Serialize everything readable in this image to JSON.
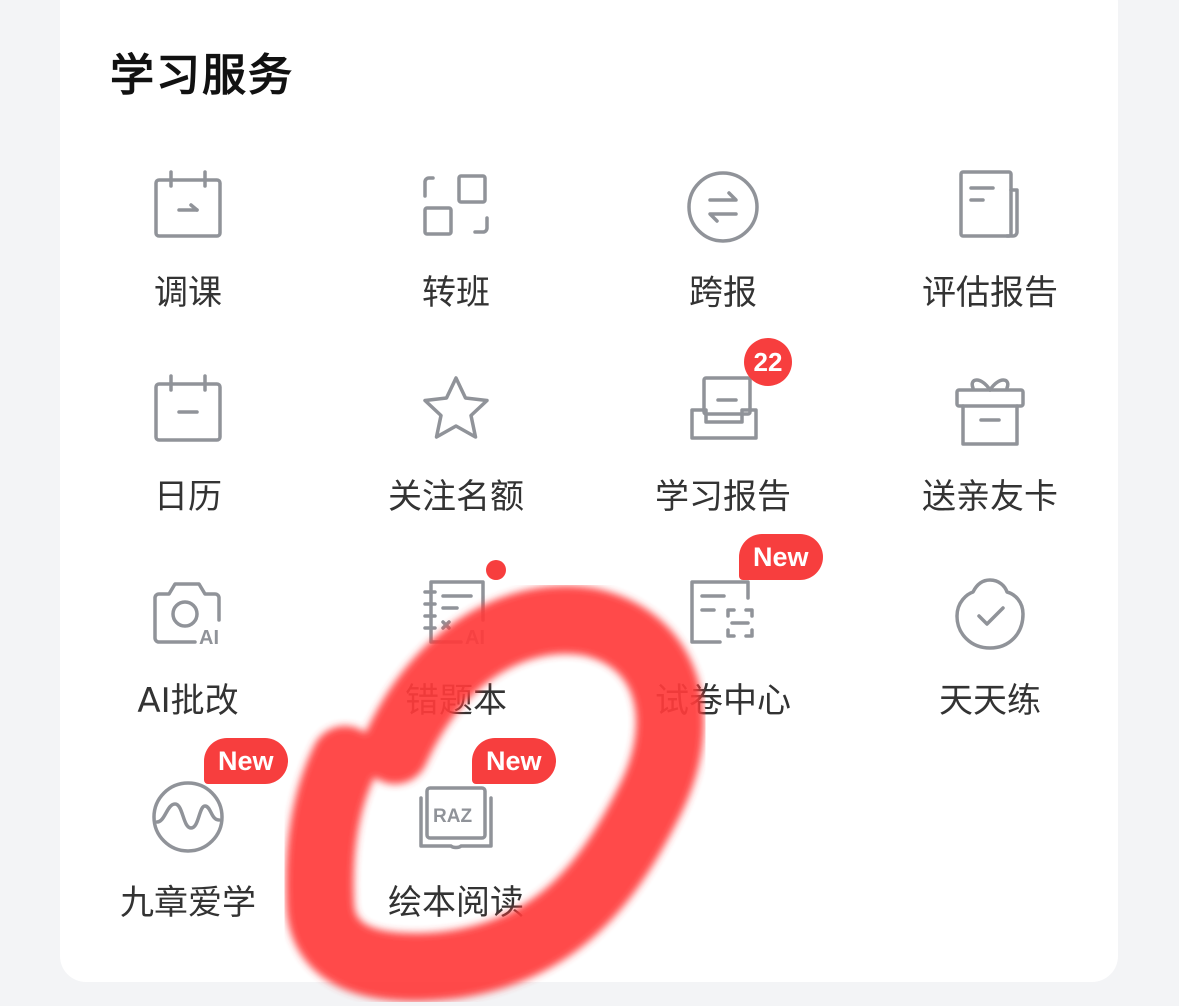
{
  "section": {
    "title": "学习服务"
  },
  "services": [
    {
      "label": "调课",
      "icon": "calendar-adjust-icon"
    },
    {
      "label": "转班",
      "icon": "transfer-class-icon"
    },
    {
      "label": "跨报",
      "icon": "exchange-circle-icon"
    },
    {
      "label": "评估报告",
      "icon": "document-report-icon"
    },
    {
      "label": "日历",
      "icon": "calendar-icon"
    },
    {
      "label": "关注名额",
      "icon": "star-icon"
    },
    {
      "label": "学习报告",
      "icon": "inbox-tray-icon",
      "badge": "22"
    },
    {
      "label": "送亲友卡",
      "icon": "gift-box-icon"
    },
    {
      "label": "AI批改",
      "icon": "camera-ai-icon"
    },
    {
      "label": "错题本",
      "icon": "notebook-ai-icon",
      "badge_dot": true
    },
    {
      "label": "试卷中心",
      "icon": "exam-scan-icon",
      "badge": "New"
    },
    {
      "label": "天天练",
      "icon": "daily-practice-icon"
    },
    {
      "label": "九章爱学",
      "icon": "wave-circle-icon",
      "badge": "New"
    },
    {
      "label": "绘本阅读",
      "icon": "raz-book-icon",
      "badge": "New"
    }
  ],
  "colors": {
    "icon_stroke": "#909399",
    "badge": "#f73e3e",
    "annotation": "#ff2a2a"
  }
}
